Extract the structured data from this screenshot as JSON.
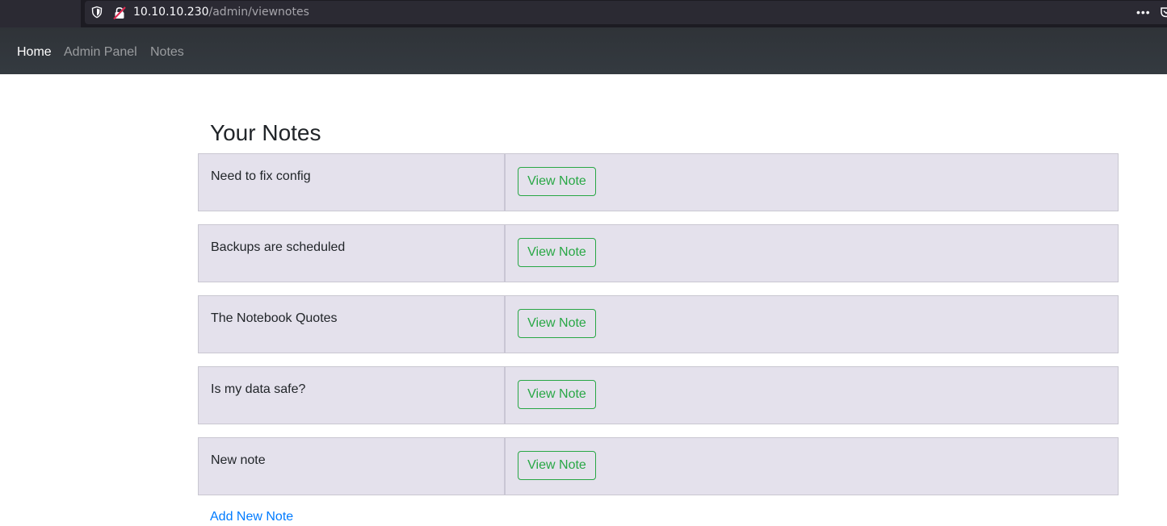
{
  "browser": {
    "url_host": "10.10.10.230",
    "url_path": "/admin/viewnotes",
    "more_label": "•••"
  },
  "nav": {
    "links": [
      "Home",
      "Admin Panel",
      "Notes"
    ]
  },
  "main": {
    "title": "Your Notes",
    "notes": [
      {
        "title": "Need to fix config",
        "button": "View Note"
      },
      {
        "title": "Backups are scheduled",
        "button": "View Note"
      },
      {
        "title": "The Notebook Quotes",
        "button": "View Note"
      },
      {
        "title": "Is my data safe?",
        "button": "View Note"
      },
      {
        "title": "New note",
        "button": "View Note"
      }
    ],
    "add_link": "Add New Note"
  },
  "colors": {
    "navbar": "#343a40",
    "note_row": "#e4e1ec",
    "button": "#28a745",
    "link": "#007bff"
  }
}
